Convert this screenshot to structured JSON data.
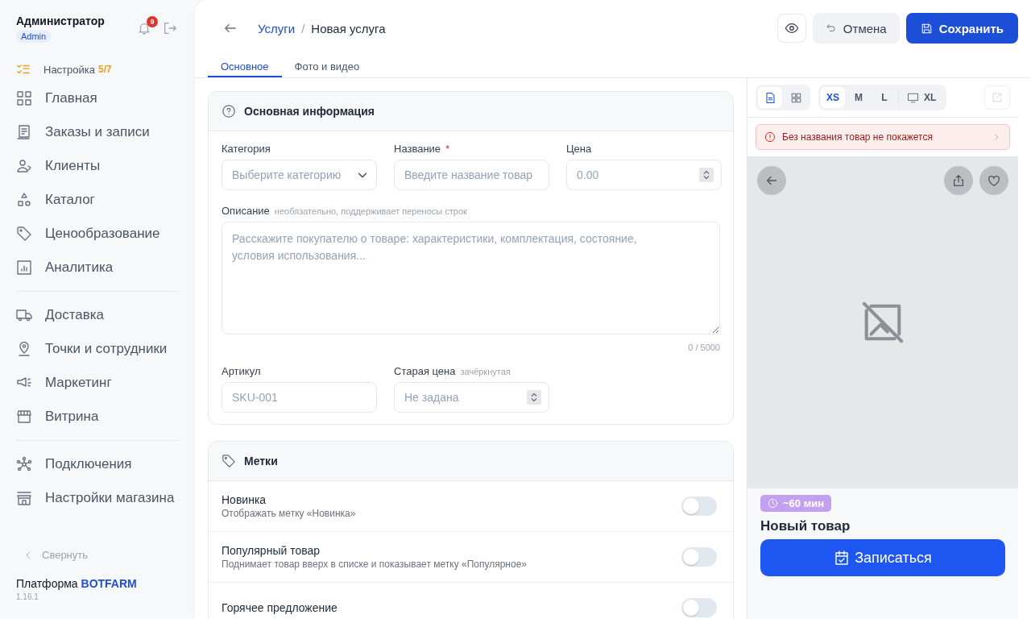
{
  "sidebar": {
    "user": {
      "name": "Администратор",
      "role": "Admin"
    },
    "notifications": {
      "count": "9"
    },
    "setup": {
      "label": "Настройка",
      "progress": "5/7",
      "complete": false
    },
    "groups": [
      {
        "items": [
          {
            "label": "Главная"
          },
          {
            "label": "Заказы и записи"
          },
          {
            "label": "Клиенты"
          },
          {
            "label": "Каталог"
          },
          {
            "label": "Ценообразование"
          },
          {
            "label": "Аналитика"
          }
        ]
      },
      {
        "items": [
          {
            "label": "Доставка"
          },
          {
            "label": "Точки и сотрудники"
          },
          {
            "label": "Маркетинг"
          },
          {
            "label": "Витрина"
          }
        ]
      },
      {
        "items": [
          {
            "label": "Подключения"
          },
          {
            "label": "Настройки магазина"
          }
        ]
      }
    ],
    "collapse": "Свернуть",
    "platform": {
      "text": "Платформа **BOTFARM**",
      "version": "1.16.1"
    }
  },
  "header": {
    "breadcrumb": {
      "parent": "Услуги",
      "separator": "/",
      "current": "Новая услуга"
    },
    "cancel": "Отмена",
    "save": "Сохранить"
  },
  "tabs": [
    {
      "label": "Основное",
      "selected": true
    },
    {
      "label": "Фото и видео",
      "selected": false
    }
  ],
  "basic_info": {
    "title": "Основная информация",
    "category": {
      "label": "Категория",
      "placeholder": "Выберите категорию"
    },
    "name": {
      "label": "Название",
      "required_mark": "*",
      "placeholder": "Введите название товар"
    },
    "price": {
      "label": "Цена",
      "placeholder": "0.00"
    },
    "description": {
      "label": "Описание",
      "hint": "необязательно, поддерживает переносы строк",
      "placeholder": "Расскажите покупателю о товаре: характеристики, комплектация, состояние, условия использования...",
      "counter": "0 / 5000"
    },
    "sku": {
      "label": "Артикул",
      "placeholder": "SKU-001"
    },
    "old_price": {
      "label": "Старая цена",
      "hint": "зачёркнутая",
      "placeholder": "Не задана"
    }
  },
  "tags": {
    "title": "Метки",
    "rows": [
      {
        "title": "Новинка",
        "description": "Отображать метку «Новинка»",
        "on": false
      },
      {
        "title": "Популярный товар",
        "description": "Поднимает товар вверх в списке и показывает метку «Популярное»",
        "on": false
      },
      {
        "title": "Горячее предложение",
        "on": false
      }
    ]
  },
  "preview": {
    "view_modes": [
      {
        "selected": true
      },
      {
        "selected": false
      }
    ],
    "sizes": [
      {
        "label": "XS",
        "selected": true
      },
      {
        "label": "M",
        "selected": false
      },
      {
        "label": "L",
        "selected": false
      },
      {
        "label": "XL",
        "selected": false
      }
    ],
    "alert": "Без названия товар не покажется",
    "duration": "~60 мин",
    "title": "Новый товар",
    "book_button": "Записаться"
  }
}
